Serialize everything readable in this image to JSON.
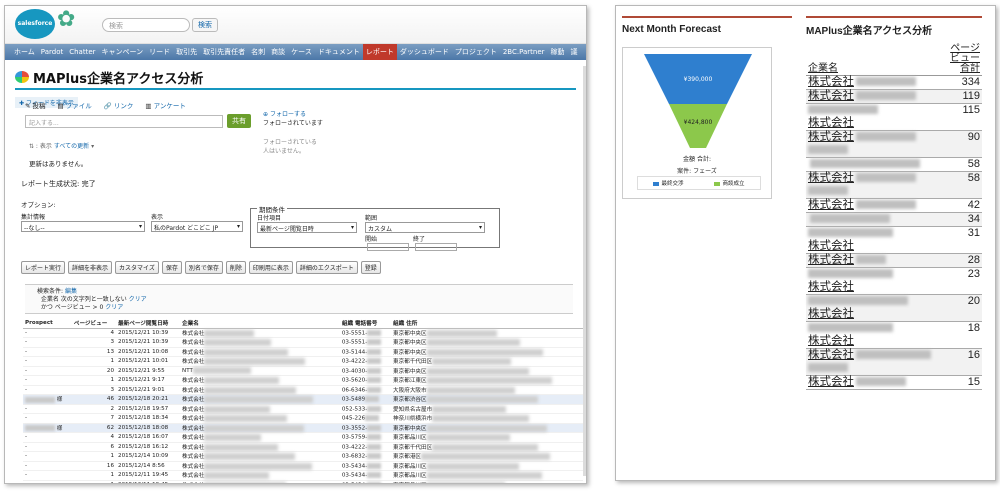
{
  "header": {
    "logo_text": "salesforce",
    "search_placeholder": "検索",
    "search_button": "検索"
  },
  "nav_tabs": [
    "ホーム",
    "Pardot",
    "Chatter",
    "キャンペーン",
    "リード",
    "取引先",
    "取引先責任者",
    "名刺",
    "商談",
    "ケース",
    "ドキュメント",
    "レポート",
    "ダッシュボード",
    "プロジェクト",
    "2BC.Partner",
    "稼動",
    "議"
  ],
  "active_tab": "レポート",
  "page_title": "MAPlus企業名アクセス分析",
  "feed": {
    "hide_label": "フィードを非表示",
    "tabs": [
      "投稿",
      "ファイル",
      "リンク",
      "アンケート"
    ],
    "placeholder": "記入する...",
    "share_button": "共有",
    "follow_button": "フォローする",
    "following_label": "フォローされています",
    "followers_text": "フォローされている人はいません。",
    "sort_label": "表示",
    "sort_value": "すべての更新",
    "no_updates": "更新はありません。"
  },
  "report_status": {
    "label": "レポート生成状況:",
    "value": "完了"
  },
  "options": {
    "label": "オプション:",
    "summary_label": "集計情報",
    "summary_value": "--なし--",
    "display_label": "表示",
    "display_value": "私のPardot どこどこ JP",
    "period_legend": "期間条件",
    "date_field_label": "日付項目",
    "date_field_value": "最新ページ閲覧日時",
    "range_label": "範囲",
    "range_value": "カスタム",
    "start_label": "開始",
    "end_label": "終了"
  },
  "buttons": [
    "レポート実行",
    "詳細を非表示",
    "カスタマイズ",
    "保存",
    "別名で保存",
    "削除",
    "印刷用に表示",
    "詳細のエクスポート",
    "登録"
  ],
  "filters": {
    "label": "検索条件:",
    "edit_link": "編集",
    "line1": "企業名 次の文字列と一致しない",
    "line2": "かつ ページビュー > 0",
    "clear": "クリア"
  },
  "report_table": {
    "columns": [
      "Prospect",
      "ページビュー",
      "最新ページ閲覧日時",
      "企業名",
      "組織 電話番号",
      "組織 住所"
    ],
    "rows": [
      {
        "p": "-",
        "pv": "4",
        "dt": "2015/12/21 10:39",
        "co": "株式会社",
        "tel": "03-5551-",
        "addr": "東京都中央区",
        "hl": false
      },
      {
        "p": "-",
        "pv": "3",
        "dt": "2015/12/21 10:39",
        "co": "株式会社",
        "tel": "03-5551-",
        "addr": "東京都中央区",
        "hl": false
      },
      {
        "p": "-",
        "pv": "13",
        "dt": "2015/12/21 10:08",
        "co": "株式会社",
        "tel": "03-5144-",
        "addr": "東京都中央区",
        "hl": false
      },
      {
        "p": "-",
        "pv": "1",
        "dt": "2015/12/21 10:01",
        "co": "株式会社",
        "tel": "03-4222-",
        "addr": "東京都千代田区",
        "hl": false
      },
      {
        "p": "-",
        "pv": "20",
        "dt": "2015/12/21 9:55",
        "co": "NTT",
        "tel": "03-4030-",
        "addr": "東京都中央区",
        "hl": false
      },
      {
        "p": "-",
        "pv": "1",
        "dt": "2015/12/21 9:17",
        "co": "株式会社",
        "tel": "03-5620-",
        "addr": "東京都江東区",
        "hl": false
      },
      {
        "p": "-",
        "pv": "3",
        "dt": "2015/12/21 9:01",
        "co": "株式会社",
        "tel": "06-6346-",
        "addr": "大阪府大阪市",
        "hl": false
      },
      {
        "p": "様",
        "pv": "46",
        "dt": "2015/12/18 20:21",
        "co": "株式会社",
        "tel": "03-5489",
        "addr": "東京都渋谷区",
        "hl": true
      },
      {
        "p": "-",
        "pv": "2",
        "dt": "2015/12/18 19:57",
        "co": "株式会社",
        "tel": "052-533-",
        "addr": "愛知県名古屋市",
        "hl": false
      },
      {
        "p": "-",
        "pv": "7",
        "dt": "2015/12/18 18:34",
        "co": "株式会社",
        "tel": "045-226",
        "addr": "神奈川県横浜市",
        "hl": false
      },
      {
        "p": "様",
        "pv": "62",
        "dt": "2015/12/18 18:08",
        "co": "株式会社",
        "tel": "03-3552-",
        "addr": "東京都中央区",
        "hl": true
      },
      {
        "p": "-",
        "pv": "4",
        "dt": "2015/12/18 16:07",
        "co": "株式会社",
        "tel": "03-5759-",
        "addr": "東京都品川区",
        "hl": false
      },
      {
        "p": "-",
        "pv": "6",
        "dt": "2015/12/18 16:12",
        "co": "株式会社",
        "tel": "03-4222-",
        "addr": "東京都千代田区",
        "hl": false
      },
      {
        "p": "-",
        "pv": "1",
        "dt": "2015/12/14 10:09",
        "co": "株式会社",
        "tel": "03-6832-",
        "addr": "東京都港区",
        "hl": false
      },
      {
        "p": "-",
        "pv": "16",
        "dt": "2015/12/14 8:56",
        "co": "株式会社",
        "tel": "03-5434-",
        "addr": "東京都品川区",
        "hl": false
      },
      {
        "p": "-",
        "pv": "1",
        "dt": "2015/12/11 19:45",
        "co": "株式会社",
        "tel": "03-5434-",
        "addr": "東京都品川区",
        "hl": false
      },
      {
        "p": "-",
        "pv": "1",
        "dt": "2015/12/11 19:45",
        "co": "株式会社",
        "tel": "03-5434-",
        "addr": "東京都品川区",
        "hl": false
      }
    ]
  },
  "forecast": {
    "title": "Next Month Forecast",
    "total_label": "金額 合計:",
    "group_label": "案件: フェーズ",
    "legend": [
      {
        "label": "最終交渉",
        "color": "#2f7fcf"
      },
      {
        "label": "商談成立",
        "color": "#8cc84b"
      }
    ]
  },
  "chart_data": {
    "type": "funnel",
    "categories": [
      "最終交渉",
      "商談成立"
    ],
    "values_label": [
      "¥390,000",
      "¥424,800"
    ],
    "values": [
      390000,
      424800
    ]
  },
  "ma_panel": {
    "title": "MAPlus企業名アクセス分析",
    "col_company": "企業名",
    "col_pv": "ページビュー合計",
    "rows": [
      {
        "name": "株式会社",
        "pv": "334",
        "bw": 60,
        "wrap": false
      },
      {
        "name": "株式会社",
        "pv": "119",
        "bw": 60,
        "wrap": false
      },
      {
        "name": "株式会社",
        "pv": "115",
        "bw": 70,
        "wrap": true,
        "pre": true
      },
      {
        "name": "株式会社",
        "pv": "90",
        "bw": 60,
        "wrap": true
      },
      {
        "name": "",
        "pv": "58",
        "bw": 110,
        "wrap": false
      },
      {
        "name": "株式会社",
        "pv": "58",
        "bw": 60,
        "wrap": true
      },
      {
        "name": "株式会社",
        "pv": "42",
        "bw": 60,
        "wrap": false
      },
      {
        "name": "",
        "pv": "34",
        "bw": 80,
        "wrap": false
      },
      {
        "name": "株式会社",
        "pv": "31",
        "bw": 85,
        "wrap": true,
        "pre": true
      },
      {
        "name": "株式会社",
        "pv": "28",
        "bw": 30,
        "wrap": false
      },
      {
        "name": "株式会社",
        "pv": "23",
        "bw": 85,
        "wrap": true,
        "pre": true
      },
      {
        "name": "株式会社",
        "pv": "20",
        "bw": 100,
        "wrap": true,
        "pre": true
      },
      {
        "name": "株式会社",
        "pv": "18",
        "bw": 85,
        "wrap": true,
        "pre": true
      },
      {
        "name": "株式会社",
        "pv": "16",
        "bw": 75,
        "wrap": true
      },
      {
        "name": "株式会社",
        "pv": "15",
        "bw": 50,
        "wrap": false
      }
    ]
  }
}
